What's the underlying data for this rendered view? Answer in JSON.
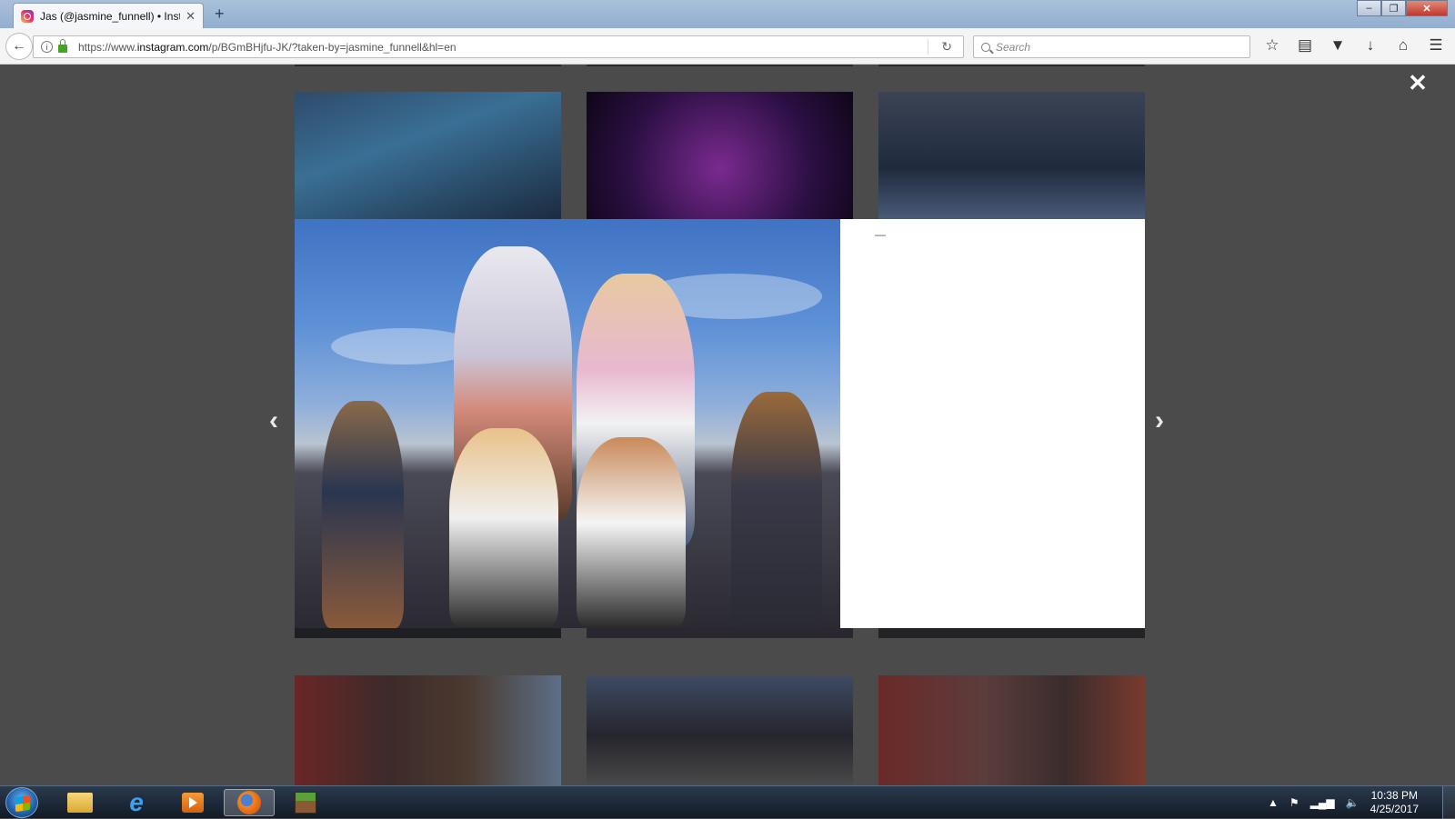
{
  "browser": {
    "tab_title": "Jas (@jasmine_funnell) • Inst",
    "tab_close": "✕",
    "new_tab": "+",
    "url_prefix": "https://www.",
    "url_domain": "instagram.com",
    "url_path": "/p/BGmBHjfu-JK/?taken-by=jasmine_funnell&hl=en",
    "search_placeholder": "Search",
    "window_buttons": {
      "minimize": "–",
      "maximize": "❐",
      "close": "✕"
    }
  },
  "modal": {
    "close_label": "✕",
    "prev_label": "‹",
    "next_label": "›",
    "panel_text": "—"
  },
  "taskbar": {
    "time": "10:38 PM",
    "date": "4/25/2017"
  },
  "colors": {
    "overlay": "#4b4b4b",
    "panel": "#ffffff",
    "taskbar": "#1b2535"
  }
}
